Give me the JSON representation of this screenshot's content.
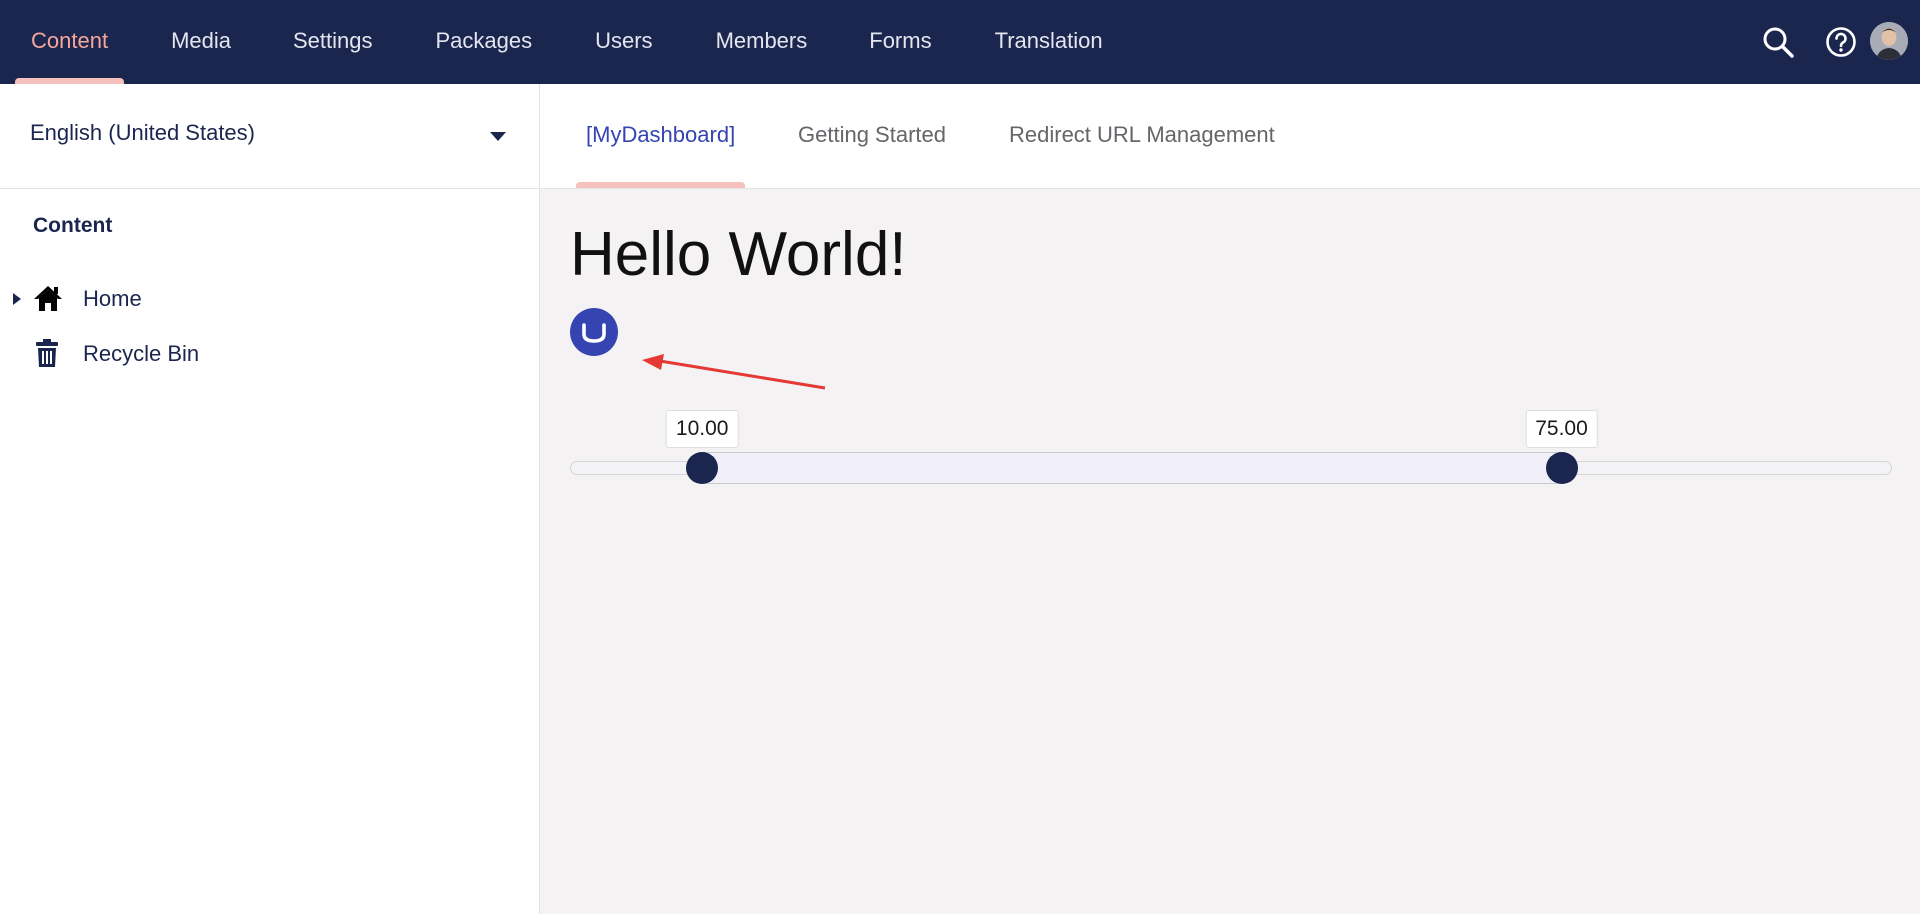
{
  "colors": {
    "header_bg": "#1b264f",
    "active_nav": "#f5a79c",
    "active_indicator": "#f5c1bc",
    "active_tab": "#3544b1",
    "logo_blue": "#3544b1",
    "annotation_arrow": "#e53935",
    "slider_handle": "#1b264f"
  },
  "header": {
    "nav": [
      {
        "label": "Content",
        "active": true
      },
      {
        "label": "Media"
      },
      {
        "label": "Settings"
      },
      {
        "label": "Packages"
      },
      {
        "label": "Users"
      },
      {
        "label": "Members"
      },
      {
        "label": "Forms"
      },
      {
        "label": "Translation"
      }
    ],
    "icons": [
      "search-icon",
      "help-icon",
      "user-avatar"
    ]
  },
  "sidebar": {
    "language": "English (United States)",
    "heading": "Content",
    "tree": [
      {
        "label": "Home",
        "icon": "home-icon",
        "expandable": true
      },
      {
        "label": "Recycle Bin",
        "icon": "trash-icon",
        "expandable": false
      }
    ]
  },
  "main": {
    "tabs": [
      {
        "label": "[MyDashboard]",
        "active": true
      },
      {
        "label": "Getting Started"
      },
      {
        "label": "Redirect URL Management"
      }
    ],
    "heading": "Hello World!",
    "logo_icon": "umbraco-logo-icon",
    "slider": {
      "min": 0,
      "max": 100,
      "low": 10,
      "high": 75,
      "low_label": "10.00",
      "high_label": "75.00"
    }
  }
}
